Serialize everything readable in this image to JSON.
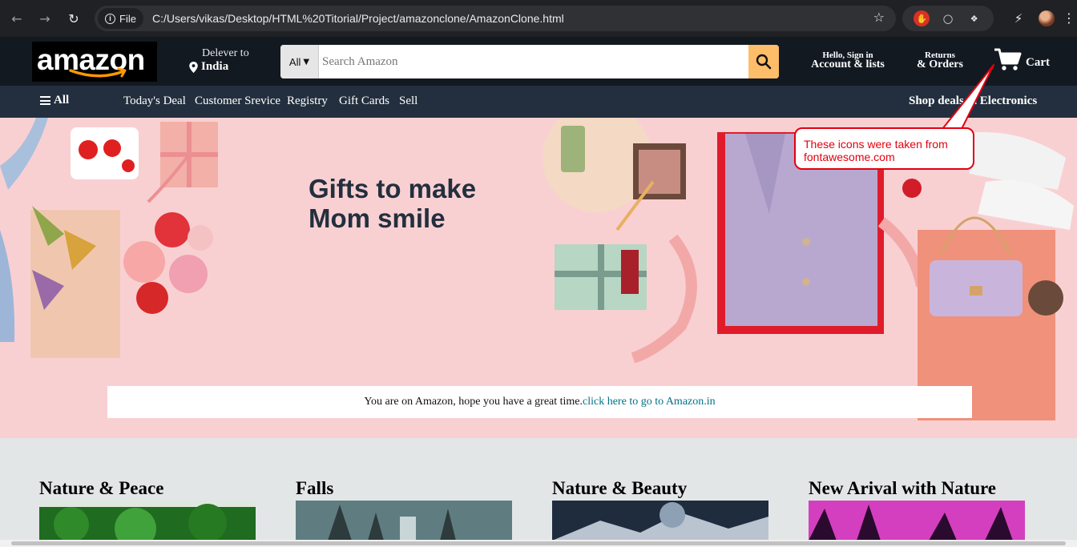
{
  "browser": {
    "file_chip": "File",
    "url": "C:/Users/vikas/Desktop/HTML%20Titorial/Project/amazonclone/AmazonClone.html"
  },
  "header": {
    "logo_text": "amazon",
    "deliver_line1": "Delever to",
    "deliver_line2": "India",
    "search_category": "All",
    "search_placeholder": "Search Amazon",
    "account_line1": "Hello, Sign in",
    "account_line2": "Account & lists",
    "orders_line1": "Returns",
    "orders_line2": "& Orders",
    "cart_label": "Cart"
  },
  "subnav": {
    "all_label": "All",
    "links": [
      "Today's Deal",
      "Customer Srevice",
      "Registry",
      "Gift Cards",
      "Sell"
    ],
    "shop_deal": "Shop deals in Electronics"
  },
  "hero": {
    "title": "Gifts to make Mom smile",
    "notice_text": "You are on Amazon, hope you have a great time.",
    "notice_link": "click here to go to Amazon.in"
  },
  "callout": {
    "text": "These icons were taken from fontawesome.com"
  },
  "cards": [
    {
      "title": "Nature & Peace"
    },
    {
      "title": "Falls"
    },
    {
      "title": "Nature & Beauty"
    },
    {
      "title": "New Arival with Nature"
    }
  ],
  "colors": {
    "header_bg": "#131921",
    "subnav_bg": "#232f3e",
    "search_btn": "#febd69",
    "logo_smile": "#ff9900",
    "hero_bg": "#f9d0d2",
    "link": "#007185",
    "callout": "#e3000f"
  }
}
